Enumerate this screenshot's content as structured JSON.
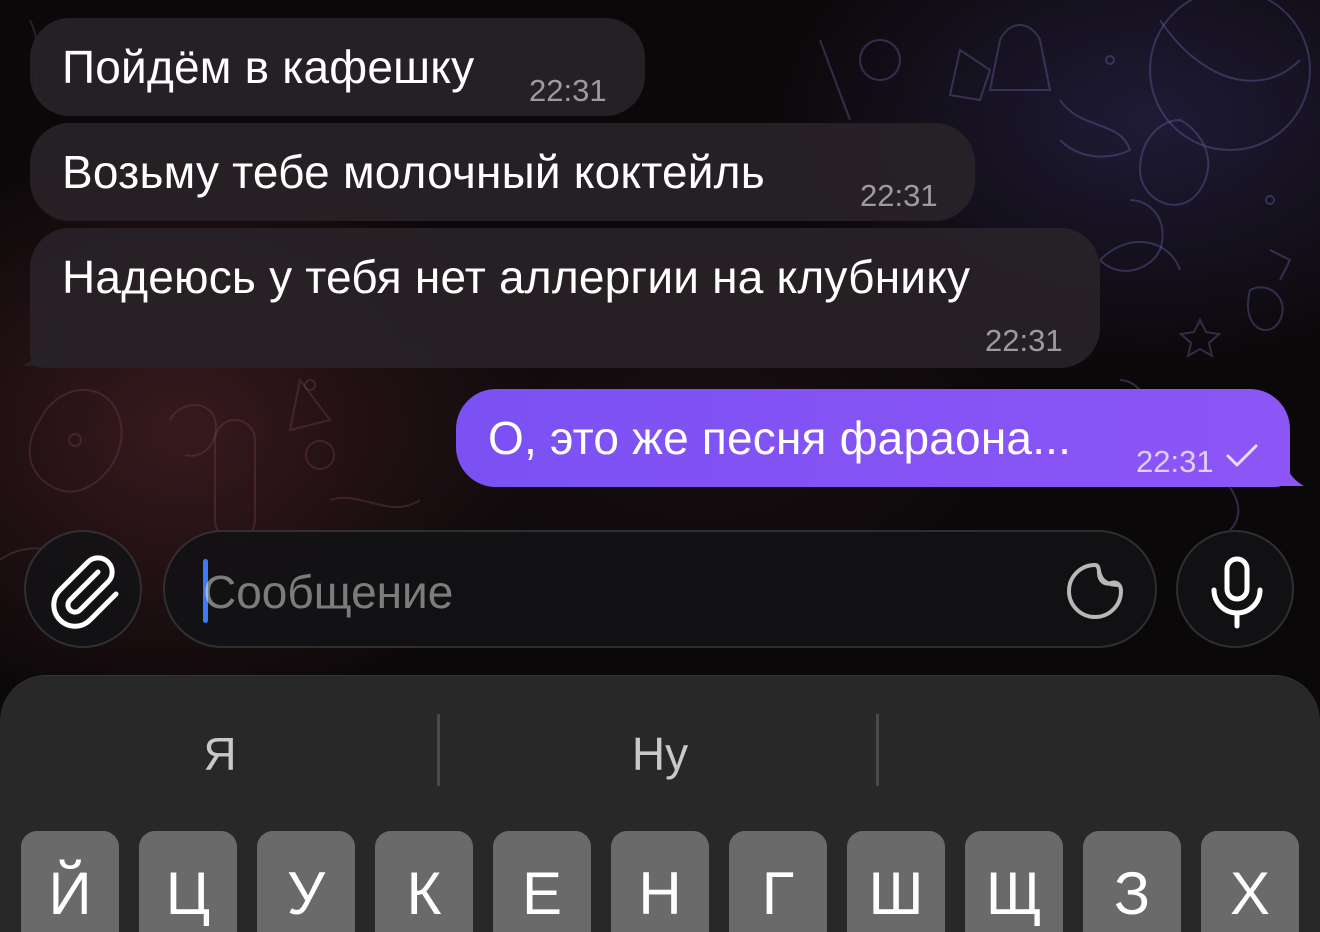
{
  "messages": [
    {
      "direction": "incoming",
      "text": "Пойдём в кафешку",
      "time": "22:31"
    },
    {
      "direction": "incoming",
      "text": "Возьму тебе молочный коктейль",
      "time": "22:31"
    },
    {
      "direction": "incoming",
      "text": "Надеюсь у тебя нет аллергии на клубнику",
      "time": "22:31"
    },
    {
      "direction": "outgoing",
      "text": "О, это же песня фараона...",
      "time": "22:31",
      "status": "sent-check"
    }
  ],
  "composer": {
    "placeholder": "Сообщение",
    "attach_icon": "paperclip-icon",
    "sticker_icon": "sticker-icon",
    "mic_icon": "microphone-icon",
    "caret_color": "#3d7bf5"
  },
  "keyboard": {
    "suggestions": [
      "Я",
      "Ну",
      ""
    ],
    "row1": [
      "Й",
      "Ц",
      "У",
      "К",
      "Е",
      "Н",
      "Г",
      "Ш",
      "Щ",
      "З",
      "Х"
    ]
  },
  "colors": {
    "outgoing_bubble": "#8455f5",
    "incoming_bubble": "#282228",
    "background": "#0b0809"
  }
}
